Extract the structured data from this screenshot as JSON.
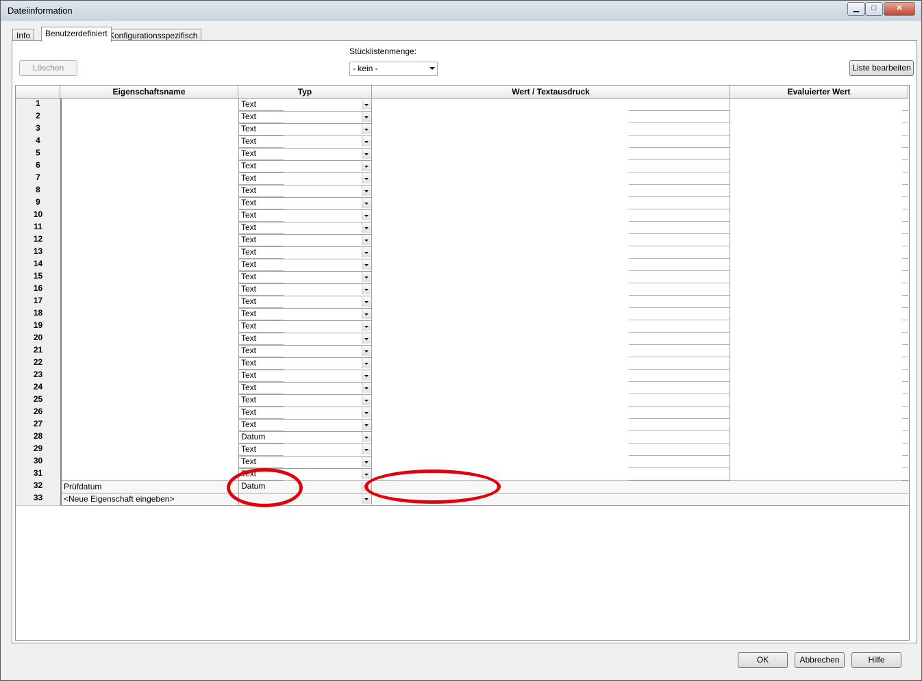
{
  "window": {
    "title": "Dateiinformation"
  },
  "tabs": [
    "Info",
    "Benutzerdefiniert",
    "Konfigurationsspezifisch"
  ],
  "toolbar": {
    "delete_label": "Löschen",
    "bom_label": "Stücklistenmenge:",
    "bom_value": "- kein -",
    "edit_list_label": "Liste bearbeiten"
  },
  "table": {
    "headers": [
      "Eigenschaftsname",
      "Typ",
      "Wert / Textausdruck",
      "Evaluierter Wert"
    ],
    "rows": [
      {
        "n": "1",
        "name": "",
        "typ": "Text"
      },
      {
        "n": "2",
        "name": "",
        "typ": "Text"
      },
      {
        "n": "3",
        "name": "",
        "typ": "Text"
      },
      {
        "n": "4",
        "name": "",
        "typ": "Text"
      },
      {
        "n": "5",
        "name": "",
        "typ": "Text"
      },
      {
        "n": "6",
        "name": "",
        "typ": "Text"
      },
      {
        "n": "7",
        "name": "",
        "typ": "Text"
      },
      {
        "n": "8",
        "name": "",
        "typ": "Text"
      },
      {
        "n": "9",
        "name": "",
        "typ": "Text"
      },
      {
        "n": "10",
        "name": "",
        "typ": "Text"
      },
      {
        "n": "11",
        "name": "",
        "typ": "Text"
      },
      {
        "n": "12",
        "name": "",
        "typ": "Text"
      },
      {
        "n": "13",
        "name": "",
        "typ": "Text"
      },
      {
        "n": "14",
        "name": "",
        "typ": "Text"
      },
      {
        "n": "15",
        "name": "",
        "typ": "Text"
      },
      {
        "n": "16",
        "name": "",
        "typ": "Text"
      },
      {
        "n": "17",
        "name": "",
        "typ": "Text"
      },
      {
        "n": "18",
        "name": "",
        "typ": "Text"
      },
      {
        "n": "19",
        "name": "",
        "typ": "Text"
      },
      {
        "n": "20",
        "name": "",
        "typ": "Text"
      },
      {
        "n": "21",
        "name": "",
        "typ": "Text"
      },
      {
        "n": "22",
        "name": "",
        "typ": "Text"
      },
      {
        "n": "23",
        "name": "",
        "typ": "Text"
      },
      {
        "n": "24",
        "name": "",
        "typ": "Text"
      },
      {
        "n": "25",
        "name": "",
        "typ": "Text"
      },
      {
        "n": "26",
        "name": "",
        "typ": "Text"
      },
      {
        "n": "27",
        "name": "",
        "typ": "Text"
      },
      {
        "n": "28",
        "name": "",
        "typ": "Datum"
      },
      {
        "n": "29",
        "name": "",
        "typ": "Text"
      },
      {
        "n": "30",
        "name": "",
        "typ": "Text"
      },
      {
        "n": "31",
        "name": "",
        "typ": "Text"
      },
      {
        "n": "32",
        "name": "Prüfdatum",
        "typ": "Datum"
      },
      {
        "n": "33",
        "name": "<Neue Eigenschaft eingeben>",
        "typ": ""
      }
    ]
  },
  "footer": {
    "ok": "OK",
    "cancel": "Abbrechen",
    "help": "Hilfe"
  },
  "colors": {
    "highlight_ring": "#e3000b"
  }
}
